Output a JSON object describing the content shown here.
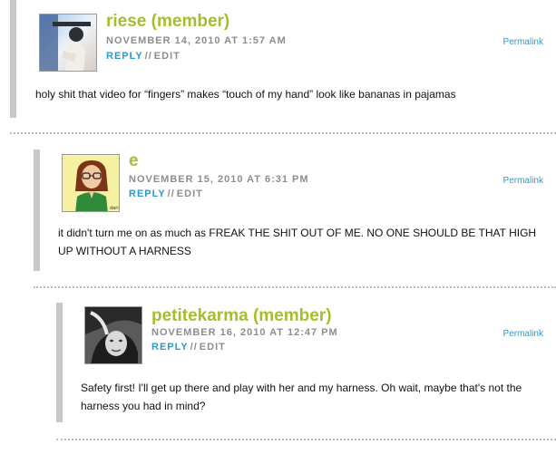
{
  "comments": [
    {
      "author": "riese (member)",
      "date": "NOVEMBER 14, 2010 AT 1:57 AM",
      "reply": "REPLY",
      "separator": "//",
      "edit": "EDIT",
      "permalink": "Permalink",
      "text": "holy shit that video for “fingers” makes “touch of my hand” look like bananas in pajamas"
    },
    {
      "author": "e",
      "date": "NOVEMBER 15, 2010 AT 6:31 PM",
      "reply": "REPLY",
      "separator": "//",
      "edit": "EDIT",
      "permalink": "Permalink",
      "text": "it didn't turn me on as much as FREAK THE SHIT OUT OF ME. NO ONE SHOULD BE THAT HIGH UP WITHOUT A HARNESS"
    },
    {
      "author": "petitekarma (member)",
      "date": "NOVEMBER 16, 2010 AT 12:47 PM",
      "reply": "REPLY",
      "separator": "//",
      "edit": "EDIT",
      "permalink": "Permalink",
      "text": "Safety first! I'll get up there and play with her and my harness. Oh wait, maybe that's not the harness you had in mind?"
    }
  ],
  "avatars": [
    {
      "icon": "user-photo-icon"
    },
    {
      "icon": "cartoon-girl-avatar-icon"
    },
    {
      "icon": "user-photo-icon"
    }
  ],
  "colors": {
    "author": "#a8bd2e",
    "link": "#2a9bc7",
    "meta": "#8d8d8d",
    "bar": "#c8c8c8"
  }
}
